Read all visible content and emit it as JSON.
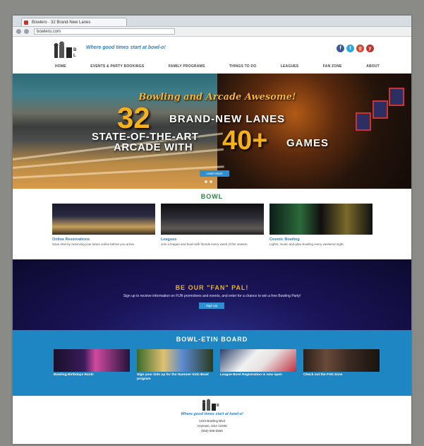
{
  "browser": {
    "tab_title": "Bowlero · 32 Brand-New Lanes",
    "url": "bowlero.com"
  },
  "header": {
    "tagline": "Where good times start at bowl-o!"
  },
  "social": [
    {
      "icon": "facebook-icon",
      "glyph": "f",
      "color": "#3b5998"
    },
    {
      "icon": "twitter-icon",
      "glyph": "t",
      "color": "#2aa9e0"
    },
    {
      "icon": "googleplus-icon",
      "glyph": "g",
      "color": "#d3432e"
    },
    {
      "icon": "youtube-icon",
      "glyph": "y",
      "color": "#c4302b"
    }
  ],
  "nav": [
    "HOME",
    "EVENTS & PARTY BOOKINGS",
    "FAMILY PROGRAMS",
    "THINGS TO DO",
    "LEAGUES",
    "FAN ZONE",
    "ABOUT"
  ],
  "hero": {
    "script_line": "Bowling and Arcade Awesome!",
    "number_lanes": "32",
    "lanes_text": "BRAND-NEW LANES",
    "arcade_line1": "STATE-OF-THE-ART",
    "arcade_line2": "ARCADE WITH",
    "number_games": "40+",
    "games_text": "GAMES",
    "button": "Learn More"
  },
  "bowl": {
    "heading": "BOWL",
    "cards": [
      {
        "title": "Online Reservations",
        "desc": "Save time by reserving your lanes online before you arrive."
      },
      {
        "title": "Leagues",
        "desc": "Join a league and bowl with friends every week of the season."
      },
      {
        "title": "Cosmic Bowling",
        "desc": "Lights, music and glow bowling every weekend night."
      }
    ]
  },
  "fan": {
    "title": "BE OUR \"FAN\" PAL!",
    "text": "Sign up to receive information on FUN promotions and events, and enter for a chance to win a free Bowling Party!",
    "button": "Sign Up"
  },
  "board": {
    "title": "BOWL-ETIN BOARD",
    "posts": [
      {
        "caption": "Bowling Birthdays Rock!"
      },
      {
        "caption": "Sign your kids up for the Summer Kids Bowl program"
      },
      {
        "caption": "League Bowl Registration is now open"
      },
      {
        "caption": "Check out the FAN Zone"
      }
    ]
  },
  "footer": {
    "tagline": "Where good times start at bowl-o!",
    "address1": "1234 Bowling Blvd",
    "address2": "Anytown, USA 12345",
    "phone": "(555) 555-5555"
  },
  "colors": {
    "accent": "#2f7fc4",
    "heading_green": "#1f8a3a",
    "hero_gold": "#f5b11b",
    "board_blue": "#1f86c4"
  }
}
